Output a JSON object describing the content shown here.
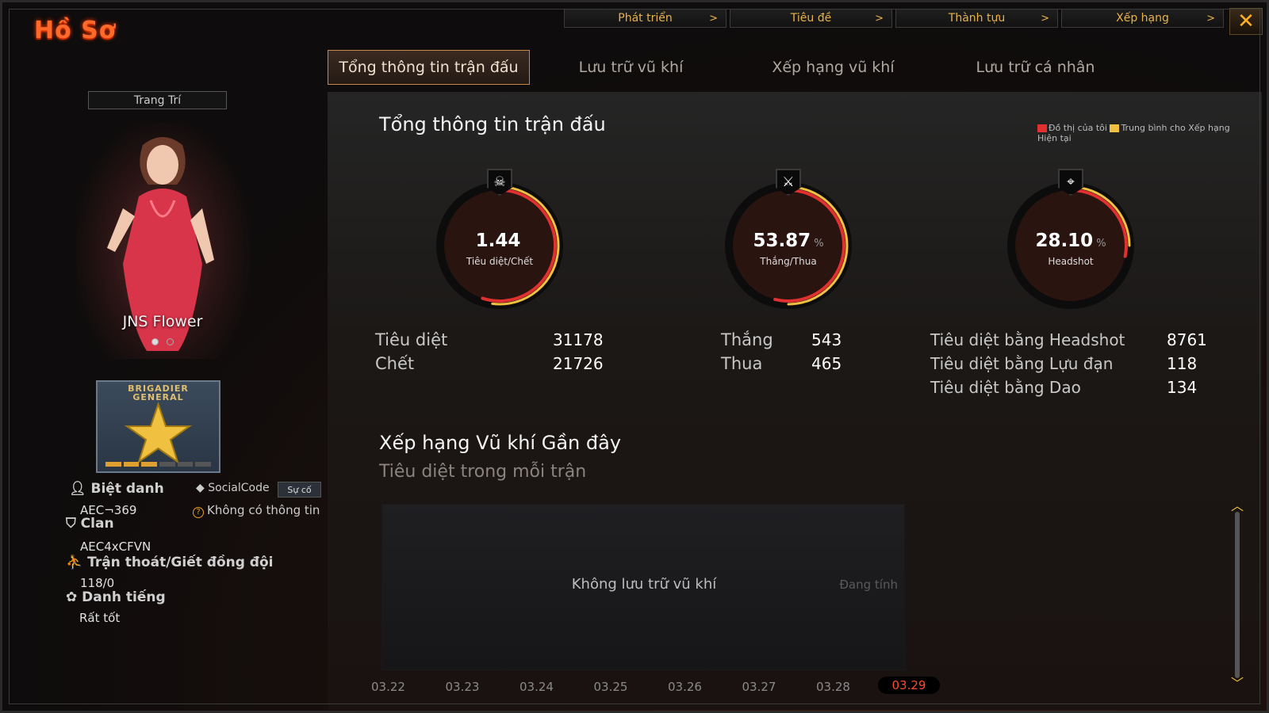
{
  "page_title": "Hồ Sơ",
  "top_menu": [
    {
      "label": "Phát triển",
      "chevron": ">"
    },
    {
      "label": "Tiêu đề",
      "chevron": ">"
    },
    {
      "label": "Thành tựu",
      "chevron": ">"
    },
    {
      "label": "Xếp hạng",
      "chevron": ">"
    }
  ],
  "close_label": "✕",
  "tabs": [
    {
      "label": "Tổng thông tin trận đấu",
      "active": true
    },
    {
      "label": "Lưu trữ vũ khí",
      "active": false
    },
    {
      "label": "Xếp hạng vũ khí",
      "active": false
    },
    {
      "label": "Lưu trữ cá nhân",
      "active": false
    }
  ],
  "profile": {
    "decor_button": "Trang Trí",
    "character_name": "JNS Flower",
    "rank_title": "BRIGADIER\nGENERAL",
    "rank_progress_segments": 6,
    "rank_progress_filled": 3,
    "nickname_label": "Biệt danh",
    "nickname_value": "AEC¬369",
    "social_label": "SocialCode",
    "social_button": "Sự cố",
    "social_info": "Không có thông tin",
    "clan_label": "Clan",
    "clan_value": "AEC4xCFVN",
    "escape_label": "Trận thoát/Giết đồng đội",
    "escape_value": "118/0",
    "reputation_label": "Danh tiếng",
    "reputation_value": "Rất tốt"
  },
  "stats_section": {
    "title": "Tổng thông tin trận đấu",
    "legend_mine": "Đồ thị của tôi",
    "legend_avg": "Trung bình cho Xếp hạng Hiện tại",
    "legend_colors": {
      "mine": "#e03030",
      "avg": "#f0c040"
    },
    "gauges": [
      {
        "value": "1.44",
        "unit": "",
        "label": "Tiêu diệt/Chết",
        "mine_fraction": 0.55,
        "avg_fraction": 0.52,
        "icon": "skull-icon"
      },
      {
        "value": "53.87",
        "unit": "%",
        "label": "Thắng/Thua",
        "mine_fraction": 0.5387,
        "avg_fraction": 0.5,
        "icon": "crossed-rifles-icon"
      },
      {
        "value": "28.10",
        "unit": "%",
        "label": "Headshot",
        "mine_fraction": 0.281,
        "avg_fraction": 0.25,
        "icon": "crosshair-icon"
      }
    ],
    "kill_death": [
      {
        "label": "Tiêu diệt",
        "value": "31178"
      },
      {
        "label": "Chết",
        "value": "21726"
      }
    ],
    "win_loss": [
      {
        "label": "Thắng",
        "value": "543"
      },
      {
        "label": "Thua",
        "value": "465"
      }
    ],
    "special_kills": [
      {
        "label": "Tiêu diệt bằng Headshot",
        "value": "8761"
      },
      {
        "label": "Tiêu diệt bằng Lựu đạn",
        "value": "118"
      },
      {
        "label": "Tiêu diệt bằng Dao",
        "value": "134"
      }
    ]
  },
  "weapon_section": {
    "title": "Xếp hạng Vũ khí Gần đây",
    "subtitle": "Tiêu diệt trong mỗi trận",
    "empty_text": "Không lưu trữ vũ khí",
    "calculating_text": "Đang tính",
    "dates": [
      "03.22",
      "03.23",
      "03.24",
      "03.25",
      "03.26",
      "03.27",
      "03.28",
      "03.29"
    ],
    "active_date": "03.29"
  },
  "scroll": {
    "up": "︿",
    "down": "﹀"
  }
}
